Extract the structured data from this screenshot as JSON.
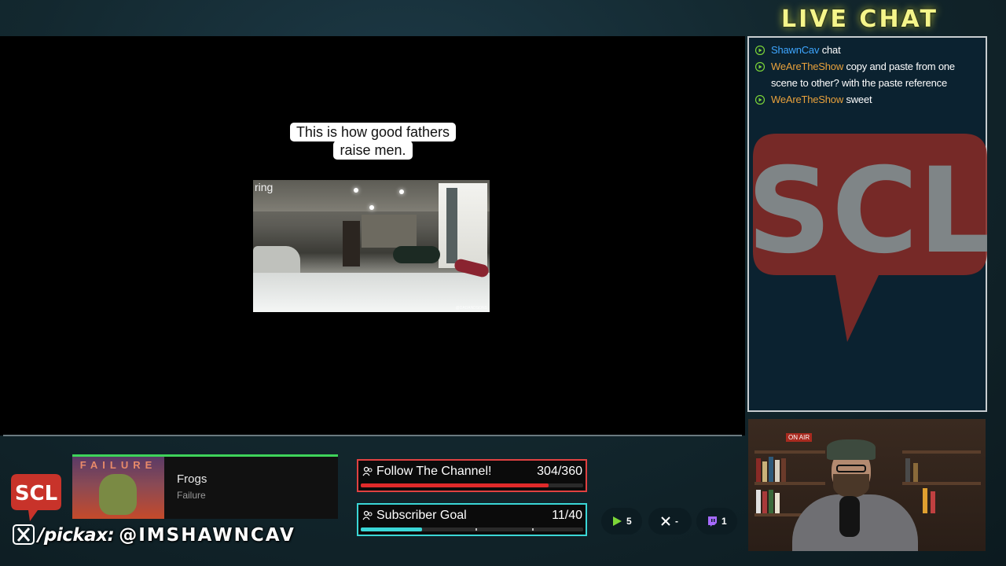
{
  "caption": {
    "line1": "This is how good fathers",
    "line2": "raise men."
  },
  "video": {
    "brand": "ring"
  },
  "live_chat": {
    "title": "LIVE CHAT",
    "messages": [
      {
        "user": "ShawnCav",
        "text": "chat",
        "user_color": "#3ea6ff"
      },
      {
        "user": "WeAreTheShow",
        "text": "copy and paste from one scene to other? with the paste reference",
        "user_color": "#e8a13c"
      },
      {
        "user": "WeAreTheShow",
        "text": "sweet",
        "user_color": "#e8a13c"
      }
    ],
    "watermark": "SCL"
  },
  "webcam": {
    "sign": "ON AIR"
  },
  "brand": {
    "logo": "SCL",
    "social_pickax": "/pickax:",
    "social_handle": "@IMSHAWNCAV",
    "x_icon": "x-logo-icon"
  },
  "now_playing": {
    "album_title": "FAILURE",
    "track": "Frogs",
    "artist": "Failure",
    "accent": "#3ed35a"
  },
  "goals": {
    "follow": {
      "label": "Follow The Channel!",
      "value": "304/360",
      "progress": 0.844,
      "color": "#e02a2a"
    },
    "subscriber": {
      "label": "Subscriber Goal",
      "value": "11/40",
      "progress": 0.275,
      "color": "#3ad6d6"
    }
  },
  "platform_counts": {
    "youtube": "5",
    "x": "-",
    "twitch": "1"
  }
}
